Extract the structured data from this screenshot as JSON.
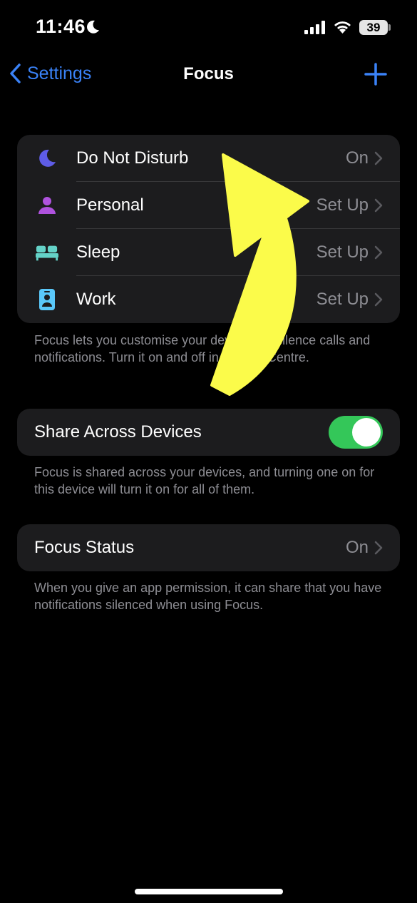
{
  "status_bar": {
    "time": "11:46",
    "focus_icon": "moon-icon",
    "signal_icon": "cellular-signal-icon",
    "wifi_icon": "wifi-icon",
    "battery": "39"
  },
  "nav": {
    "back_label": "Settings",
    "title": "Focus",
    "add_icon": "plus-icon"
  },
  "focus_modes": [
    {
      "label": "Do Not Disturb",
      "value": "On",
      "icon": "moon-icon",
      "icon_color": "#5e5ce6"
    },
    {
      "label": "Personal",
      "value": "Set Up",
      "icon": "person-icon",
      "icon_color": "#af52de"
    },
    {
      "label": "Sleep",
      "value": "Set Up",
      "icon": "bed-icon",
      "icon_color": "#64d2c8"
    },
    {
      "label": "Work",
      "value": "Set Up",
      "icon": "id-badge-icon",
      "icon_color": "#5ac8fa"
    }
  ],
  "focus_footnote": "Focus lets you customise your device and silence calls and notifications. Turn it on and off in Control Centre.",
  "share": {
    "label": "Share Across Devices",
    "enabled": true,
    "footnote": "Focus is shared across your devices, and turning one on for this device will turn it on for all of them."
  },
  "focus_status": {
    "label": "Focus Status",
    "value": "On",
    "footnote": "When you give an app permission, it can share that you have notifications silenced when using Focus."
  },
  "colors": {
    "accent": "#3a82f7",
    "toggle_on": "#34c759",
    "annotation_arrow": "#fbfb4a"
  }
}
